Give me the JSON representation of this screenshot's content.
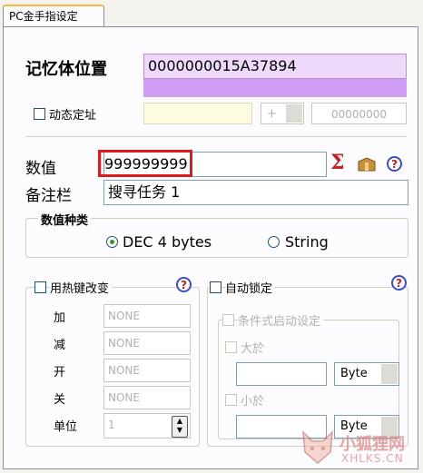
{
  "tab": {
    "label": "PC金手指设定"
  },
  "memory": {
    "label": "记忆体位置",
    "value": "0000000015A37894"
  },
  "dynamic": {
    "label": "动态定址",
    "op": "+",
    "offset": "00000000"
  },
  "value": {
    "label": "数值",
    "value": "999999999"
  },
  "note": {
    "label": "备注栏",
    "value": "搜寻任务 1"
  },
  "value_type": {
    "label": "数值种类",
    "options": [
      "DEC 4 bytes",
      "String"
    ],
    "selected": "DEC 4 bytes"
  },
  "hotkey": {
    "label": "用热键改变",
    "rows": [
      {
        "label": "加",
        "value": "NONE"
      },
      {
        "label": "减",
        "value": "NONE"
      },
      {
        "label": "开",
        "value": "NONE"
      },
      {
        "label": "关",
        "value": "NONE"
      }
    ],
    "unit_label": "单位",
    "unit_value": "1"
  },
  "autolock": {
    "label": "自动锁定",
    "conditional_label": "条件式启动设定",
    "greater_label": "大於",
    "less_label": "小於",
    "greater_type": "Byte",
    "less_type": "Byte"
  },
  "help_glyph": "?",
  "watermark": {
    "name": "小狐狸网",
    "url": "XHLKS.CN"
  },
  "icons": [
    "sigma-icon",
    "box-icon",
    "help-icon"
  ],
  "colors": {
    "memory_bg": "#eed9fb",
    "memory_bar": "#cf9df2",
    "highlight_border": "#e0191f",
    "sigma": "#cc2020"
  }
}
